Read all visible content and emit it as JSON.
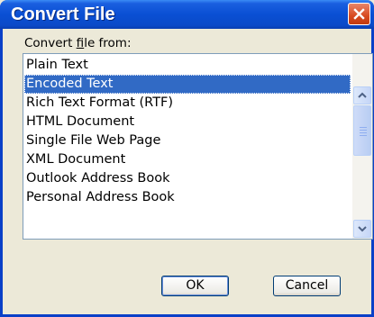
{
  "window": {
    "title": "Convert File"
  },
  "label": {
    "prefix": "Convert ",
    "accel": "f",
    "suffix": "ile from:"
  },
  "items": [
    "Plain Text",
    "Encoded Text",
    "Rich Text Format (RTF)",
    "HTML Document",
    "Single File Web Page",
    "XML Document",
    "Outlook Address Book",
    "Personal Address Book"
  ],
  "selected_item": "Encoded Text",
  "buttons": {
    "ok": "OK",
    "cancel": "Cancel"
  },
  "colors": {
    "titlebar": "#0a4fd4",
    "selection": "#316ac5",
    "close": "#d84a20"
  }
}
